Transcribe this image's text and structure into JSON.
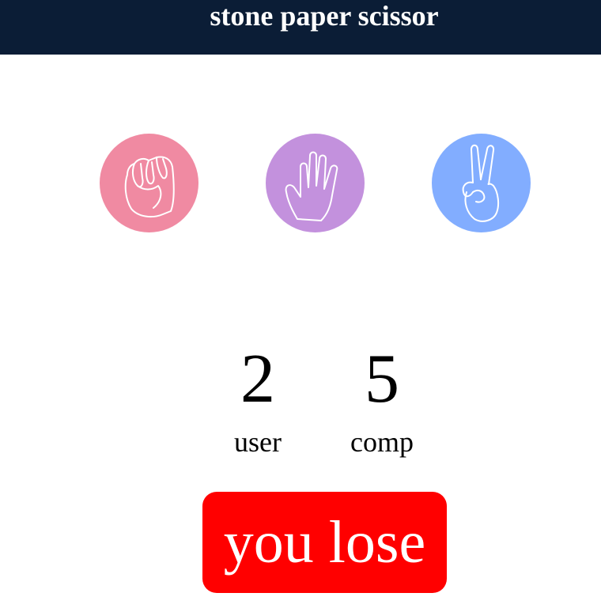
{
  "header": {
    "title": "stone paper scissor"
  },
  "choices": [
    {
      "id": "stone",
      "icon": "fist-icon",
      "color": "#f08aa2"
    },
    {
      "id": "paper",
      "icon": "open-hand-icon",
      "color": "#c391dd"
    },
    {
      "id": "scissor",
      "icon": "peace-hand-icon",
      "color": "#82adff"
    }
  ],
  "scoreboard": {
    "user_score": "2",
    "user_label": "user",
    "comp_score": "5",
    "comp_label": "comp"
  },
  "result": {
    "message": "you lose",
    "color": "#ff0000"
  },
  "colors": {
    "header_bg": "#0b1d36"
  }
}
